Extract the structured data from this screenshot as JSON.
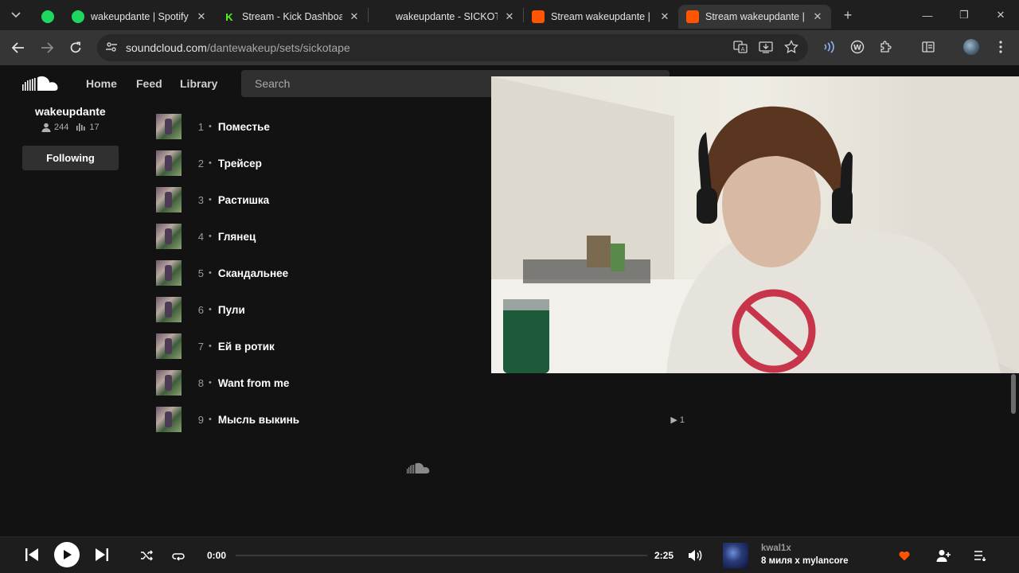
{
  "browser": {
    "tabs": [
      {
        "title": "",
        "favicon_color": "#1ed760",
        "pinned": true
      },
      {
        "title": "wakeupdante | Spotify",
        "favicon_color": "#1ed760",
        "pinned": false
      },
      {
        "title": "Stream - Kick Dashboard",
        "favicon_color": "#53fc18",
        "pinned": false
      },
      {
        "title": "wakeupdante - SICKOTAPE",
        "favicon_color": "",
        "pinned": false
      },
      {
        "title": "Stream wakeupdante | Listen",
        "favicon_color": "#ff5500",
        "pinned": false
      },
      {
        "title": "Stream wakeupdante | Listen",
        "favicon_color": "#ff5500",
        "pinned": false,
        "active": true
      }
    ],
    "url_host": "soundcloud.com",
    "url_path": "/dantewakeup/sets/sickotape"
  },
  "header": {
    "nav": [
      "Home",
      "Feed",
      "Library"
    ],
    "search_placeholder": "Search"
  },
  "profile": {
    "name": "wakeupdante",
    "followers": "244",
    "tracks": "17",
    "following_label": "Following"
  },
  "tracks": [
    {
      "num": "1",
      "name": "Поместье",
      "plays": ""
    },
    {
      "num": "2",
      "name": "Трейсер",
      "plays": ""
    },
    {
      "num": "3",
      "name": "Растишка",
      "plays": ""
    },
    {
      "num": "4",
      "name": "Глянец",
      "plays": ""
    },
    {
      "num": "5",
      "name": "Скандальнее",
      "plays": ""
    },
    {
      "num": "6",
      "name": "Пули",
      "plays": ""
    },
    {
      "num": "7",
      "name": "Ей в ротик",
      "plays": ""
    },
    {
      "num": "8",
      "name": "Want from me",
      "plays": ""
    },
    {
      "num": "9",
      "name": "Мысль выкинь",
      "plays": "1"
    }
  ],
  "player": {
    "current_time": "0:00",
    "duration": "2:25",
    "progress": 0,
    "artist": "kwal1x",
    "title": "8 миля x mylancore",
    "liked_color": "#ff5500"
  },
  "colors": {
    "accent": "#ff5500",
    "background": "#121212"
  }
}
